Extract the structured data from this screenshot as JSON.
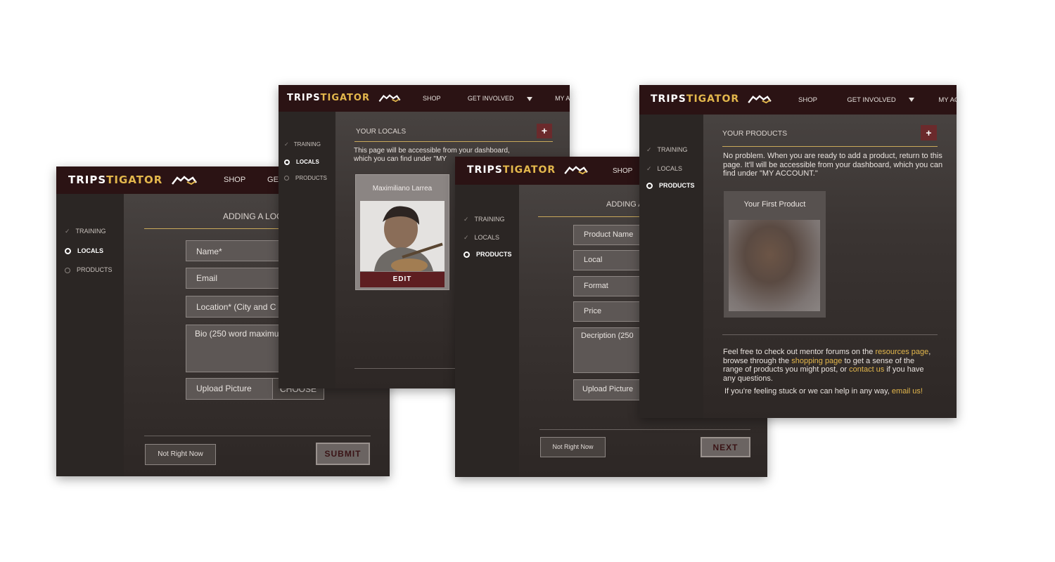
{
  "brand": {
    "word1": "TRIPS",
    "word2": "TIGATOR"
  },
  "colors": {
    "topbar": "#2b1314",
    "accent_gold": "#e3b74c",
    "accent_red": "#6b2a2c"
  },
  "nav": {
    "shop": "SHOP",
    "get_involved": "GET INVOLVED",
    "my_account": "MY ACCOUNT",
    "get_involved_cut": "GET IN"
  },
  "sidebar": {
    "training": "TRAINING",
    "locals": "LOCALS",
    "products": "PRODUCTS"
  },
  "win1": {
    "heading": "ADDING A LOCA",
    "name": "Name*",
    "email": "Email",
    "location": "Location* (City and C",
    "bio": "Bio (250 word maximu",
    "upload": "Upload Picture",
    "choose": "CHOOSE",
    "not_now": "Not Right Now",
    "submit": "SUBMIT"
  },
  "win2": {
    "heading": "YOUR LOCALS",
    "plus": "+",
    "text_line1": "This page will be accessible from your dashboard,",
    "text_line2": "which you can find under \"MY",
    "card_name": "Maximiliano Larrea",
    "edit": "EDIT"
  },
  "win3": {
    "heading": "ADDING A",
    "product_name": "Product Name",
    "local": "Local",
    "format": "Format",
    "price": "Price",
    "description": "Decription (250",
    "upload": "Upload Picture",
    "not_now": "Not Right Now",
    "next": "NEXT"
  },
  "win4": {
    "heading": "YOUR PRODUCTS",
    "plus": "+",
    "text": "No problem. When you are ready to add a product, return to this page. It'll will be accessible from your dashboard, which you can find under \"MY ACCOUNT.\"",
    "card_title": "Your First Product",
    "help_a": "Feel free to check out mentor forums on the ",
    "help_link1": "resources page",
    "help_b": ", browse through the ",
    "help_link2": "shopping page",
    "help_c": " to get a sense of the range of products you might post, or ",
    "help_link3": "contact us",
    "help_d": " if you have any questions.",
    "stuck_a": "If you're feeling stuck or we can help in any way, ",
    "stuck_link": "email us!"
  }
}
